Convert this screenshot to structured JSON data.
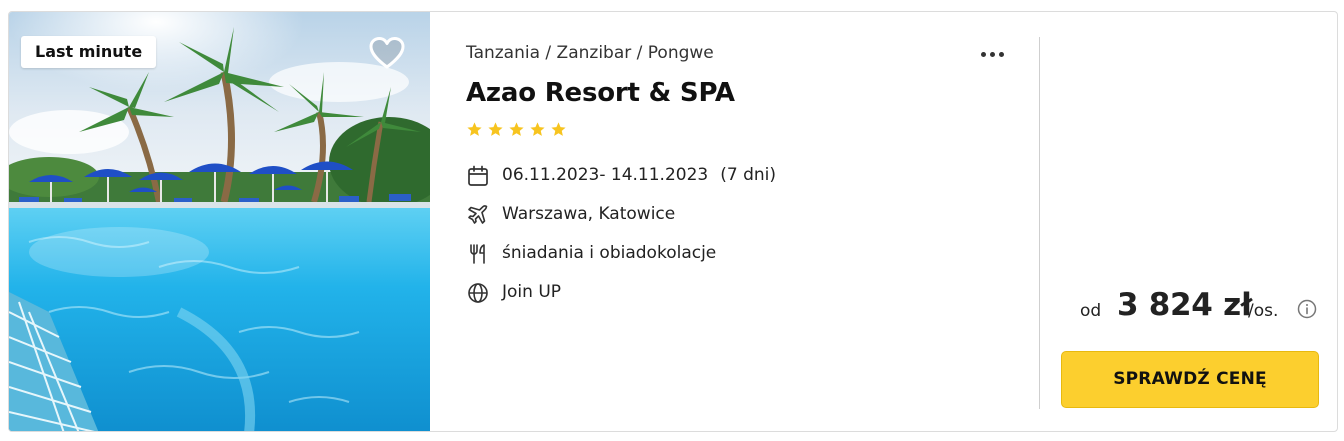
{
  "badge": {
    "label": "Last minute"
  },
  "location": {
    "breadcrumb": "Tanzania / Zanzibar / Pongwe"
  },
  "hotel": {
    "name": "Azao Resort & SPA",
    "stars": 5
  },
  "details": {
    "dates": "06.11.2023- 14.11.2023",
    "duration": "(7 dni)",
    "departure": "Warszawa, Katowice",
    "board": "śniadania i obiadokolacje",
    "operator": "Join UP"
  },
  "price": {
    "prefix": "od",
    "amount": "3 824 zł",
    "suffix": "/os."
  },
  "cta": {
    "label": "SPRAWDŹ CENĘ"
  },
  "colors": {
    "cta_background": "#fccf2e",
    "star": "#f7c41f",
    "text": "#222222",
    "pool": "#1eaee6",
    "parasol": "#1f4fc6"
  },
  "icons": {
    "favorite": "heart-icon",
    "more": "more-dots-icon",
    "dates": "calendar-icon",
    "departure": "plane-icon",
    "board": "cutlery-icon",
    "operator": "globe-icon",
    "price_info": "info-icon"
  }
}
